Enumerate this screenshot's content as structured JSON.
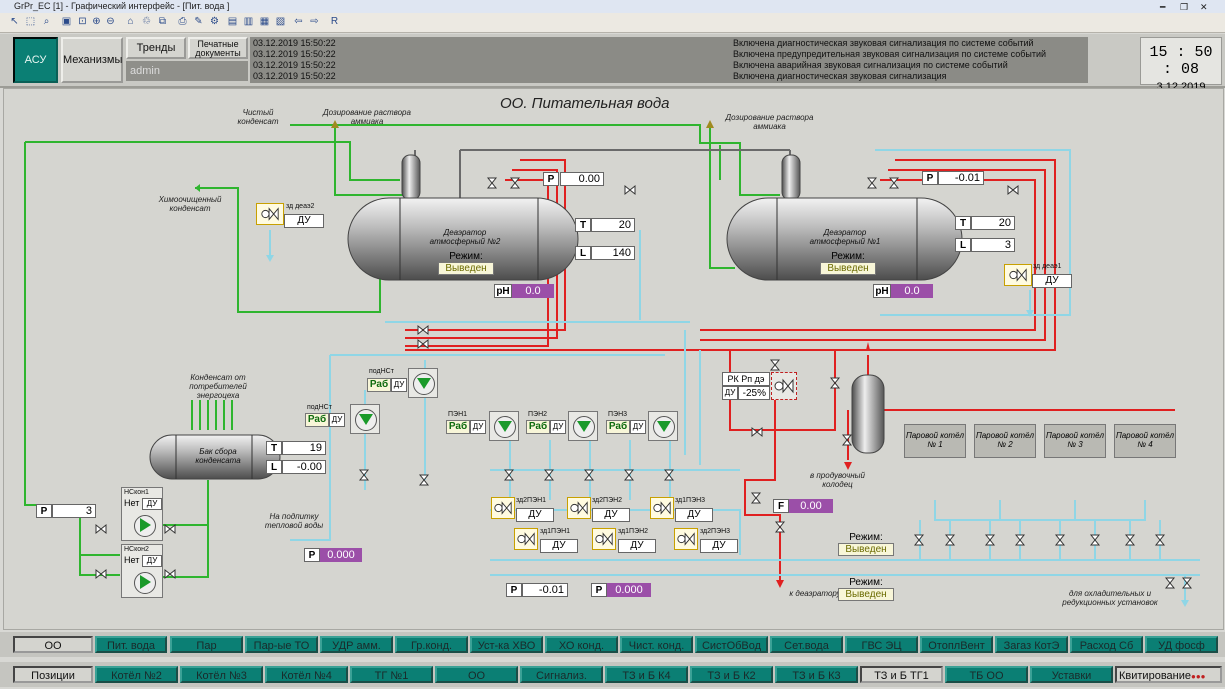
{
  "window": {
    "title": "GrPr_EC [1] - Графический интерфейс - [Пит. вода ]"
  },
  "header": {
    "asu": "АСУ",
    "mechanisms": "Механизмы",
    "trends": "Тренды",
    "print_docs": "Печатные документы",
    "user": "admin"
  },
  "events": [
    {
      "time": "03.12.2019 15:50:22",
      "msg": "Включена диагностическая звуковая сигнализация по системе событий"
    },
    {
      "time": "03.12.2019 15:50:22",
      "msg": "Включена предупредительная звуковая сигнализация по системе событий"
    },
    {
      "time": "03.12.2019 15:50:22",
      "msg": "Включена аварийная звуковая сигнализация по системе событий"
    },
    {
      "time": "03.12.2019 15:50:22",
      "msg": "Включена диагностическая звуковая сигнализация"
    }
  ],
  "clock": {
    "time": "15 : 50 : 08",
    "date": "3.12.2019"
  },
  "mimic": {
    "title": "ОО. Питательная вода",
    "labels": {
      "clean_condensate": "Чистый конденсат",
      "ammonia_dosing_1": "Дозирование раствора аммиака",
      "ammonia_dosing_2": "Дозирование раствора аммиака",
      "chem_condensate": "Химоочищенный конденсат",
      "consumer_condensate": "Конденсат от потребителей энергоцеха",
      "heat_network": "На подпитку тепловой воды",
      "purge_well": "в продувочный колодец",
      "to_deaerator": "к деаэратору",
      "cooling_units": "для охладительных и редукционных установок"
    },
    "deaerator2": {
      "name": "Деаэратор атмосферный №2",
      "mode_label": "Режим:",
      "mode": "Выведен",
      "P": "0.00",
      "T": "20",
      "L": "140",
      "pH": "0.0",
      "valve_tag": "зд деаэ2",
      "valve_du": "ДУ"
    },
    "deaerator1": {
      "name": "Деаэратор атмосферный №1",
      "mode_label": "Режим:",
      "mode": "Выведен",
      "P": "-0.01",
      "T": "20",
      "L": "3",
      "pH": "0.0",
      "valve_tag": "зд деаэ1",
      "valve_du": "ДУ"
    },
    "tank": {
      "name": "Бак сбора конденсата",
      "T": "19",
      "L": "-0.00"
    },
    "pressure_left": "3",
    "pumps_condensate": [
      {
        "name": "НСкон1",
        "state": "Нет",
        "du": "ДУ"
      },
      {
        "name": "НСкон2",
        "state": "Нет",
        "du": "ДУ"
      }
    ],
    "heating_pumps": [
      {
        "name": "подНСт",
        "state": "Раб",
        "du": "ДУ"
      },
      {
        "name": "подНСт",
        "state": "Раб",
        "du": "ДУ"
      }
    ],
    "feed_pumps": [
      {
        "name": "ПЭН1",
        "state": "Раб",
        "du": "ДУ"
      },
      {
        "name": "ПЭН2",
        "state": "Раб",
        "du": "ДУ"
      },
      {
        "name": "ПЭН3",
        "state": "Раб",
        "du": "ДУ"
      }
    ],
    "pump_valves_top": [
      {
        "tag": "зд2ПЭН1",
        "du": "ДУ"
      },
      {
        "tag": "зд2ПЭН2",
        "du": "ДУ"
      },
      {
        "tag": "зд1ПЭН3",
        "du": "ДУ"
      }
    ],
    "pump_valves_bottom": [
      {
        "tag": "зд1ПЭН1",
        "du": "ДУ"
      },
      {
        "tag": "зд1ПЭН2",
        "du": "ДУ"
      },
      {
        "tag": "зд2ПЭН3",
        "du": "ДУ"
      }
    ],
    "P_heat": "0.000",
    "P_mid1": "-0.01",
    "P_mid2": "0.000",
    "rk": {
      "name": "РК Рп дэ",
      "du": "ДУ",
      "value": "-25%"
    },
    "F": "0.00",
    "mode1": {
      "label": "Режим:",
      "value": "Выведен"
    },
    "mode2": {
      "label": "Режим:",
      "value": "Выведен"
    },
    "boilers": [
      "Паровой котёл № 1",
      "Паровой котёл № 2",
      "Паровой котёл № 3",
      "Паровой котёл № 4"
    ],
    "letters": {
      "P": "P",
      "T": "T",
      "L": "L",
      "F": "F",
      "pH": "pH"
    }
  },
  "tabs_row1": [
    "ОО",
    "Пит. вода",
    "Пар",
    "Пар-ые ТО",
    "УДР амм.",
    "Гр.конд.",
    "Уст-ка ХВО",
    "ХО конд.",
    "Чист. конд.",
    "СистОбВод",
    "Сет.вода",
    "ГВС ЭЦ",
    "ОтоплВент",
    "Загаз КотЭ",
    "Расход Сб",
    "УД фосф"
  ],
  "tabs_row2": [
    "Позиции",
    "Котёл №2",
    "Котёл №3",
    "Котёл №4",
    "ТГ №1",
    "ОО",
    "Сигнализ.",
    "ТЗ и Б К4",
    "ТЗ и Б К2",
    "ТЗ и Б К3",
    "ТЗ и Б ТГ1",
    "ТБ ОО",
    "Уставки",
    "Квитирование"
  ],
  "colors": {
    "green": "#2fb52f",
    "red": "#e02020",
    "cyan": "#8fd6e6",
    "gray": "#6a6a6a",
    "teal": "#0b7f74",
    "purple": "#9b4fa8"
  }
}
